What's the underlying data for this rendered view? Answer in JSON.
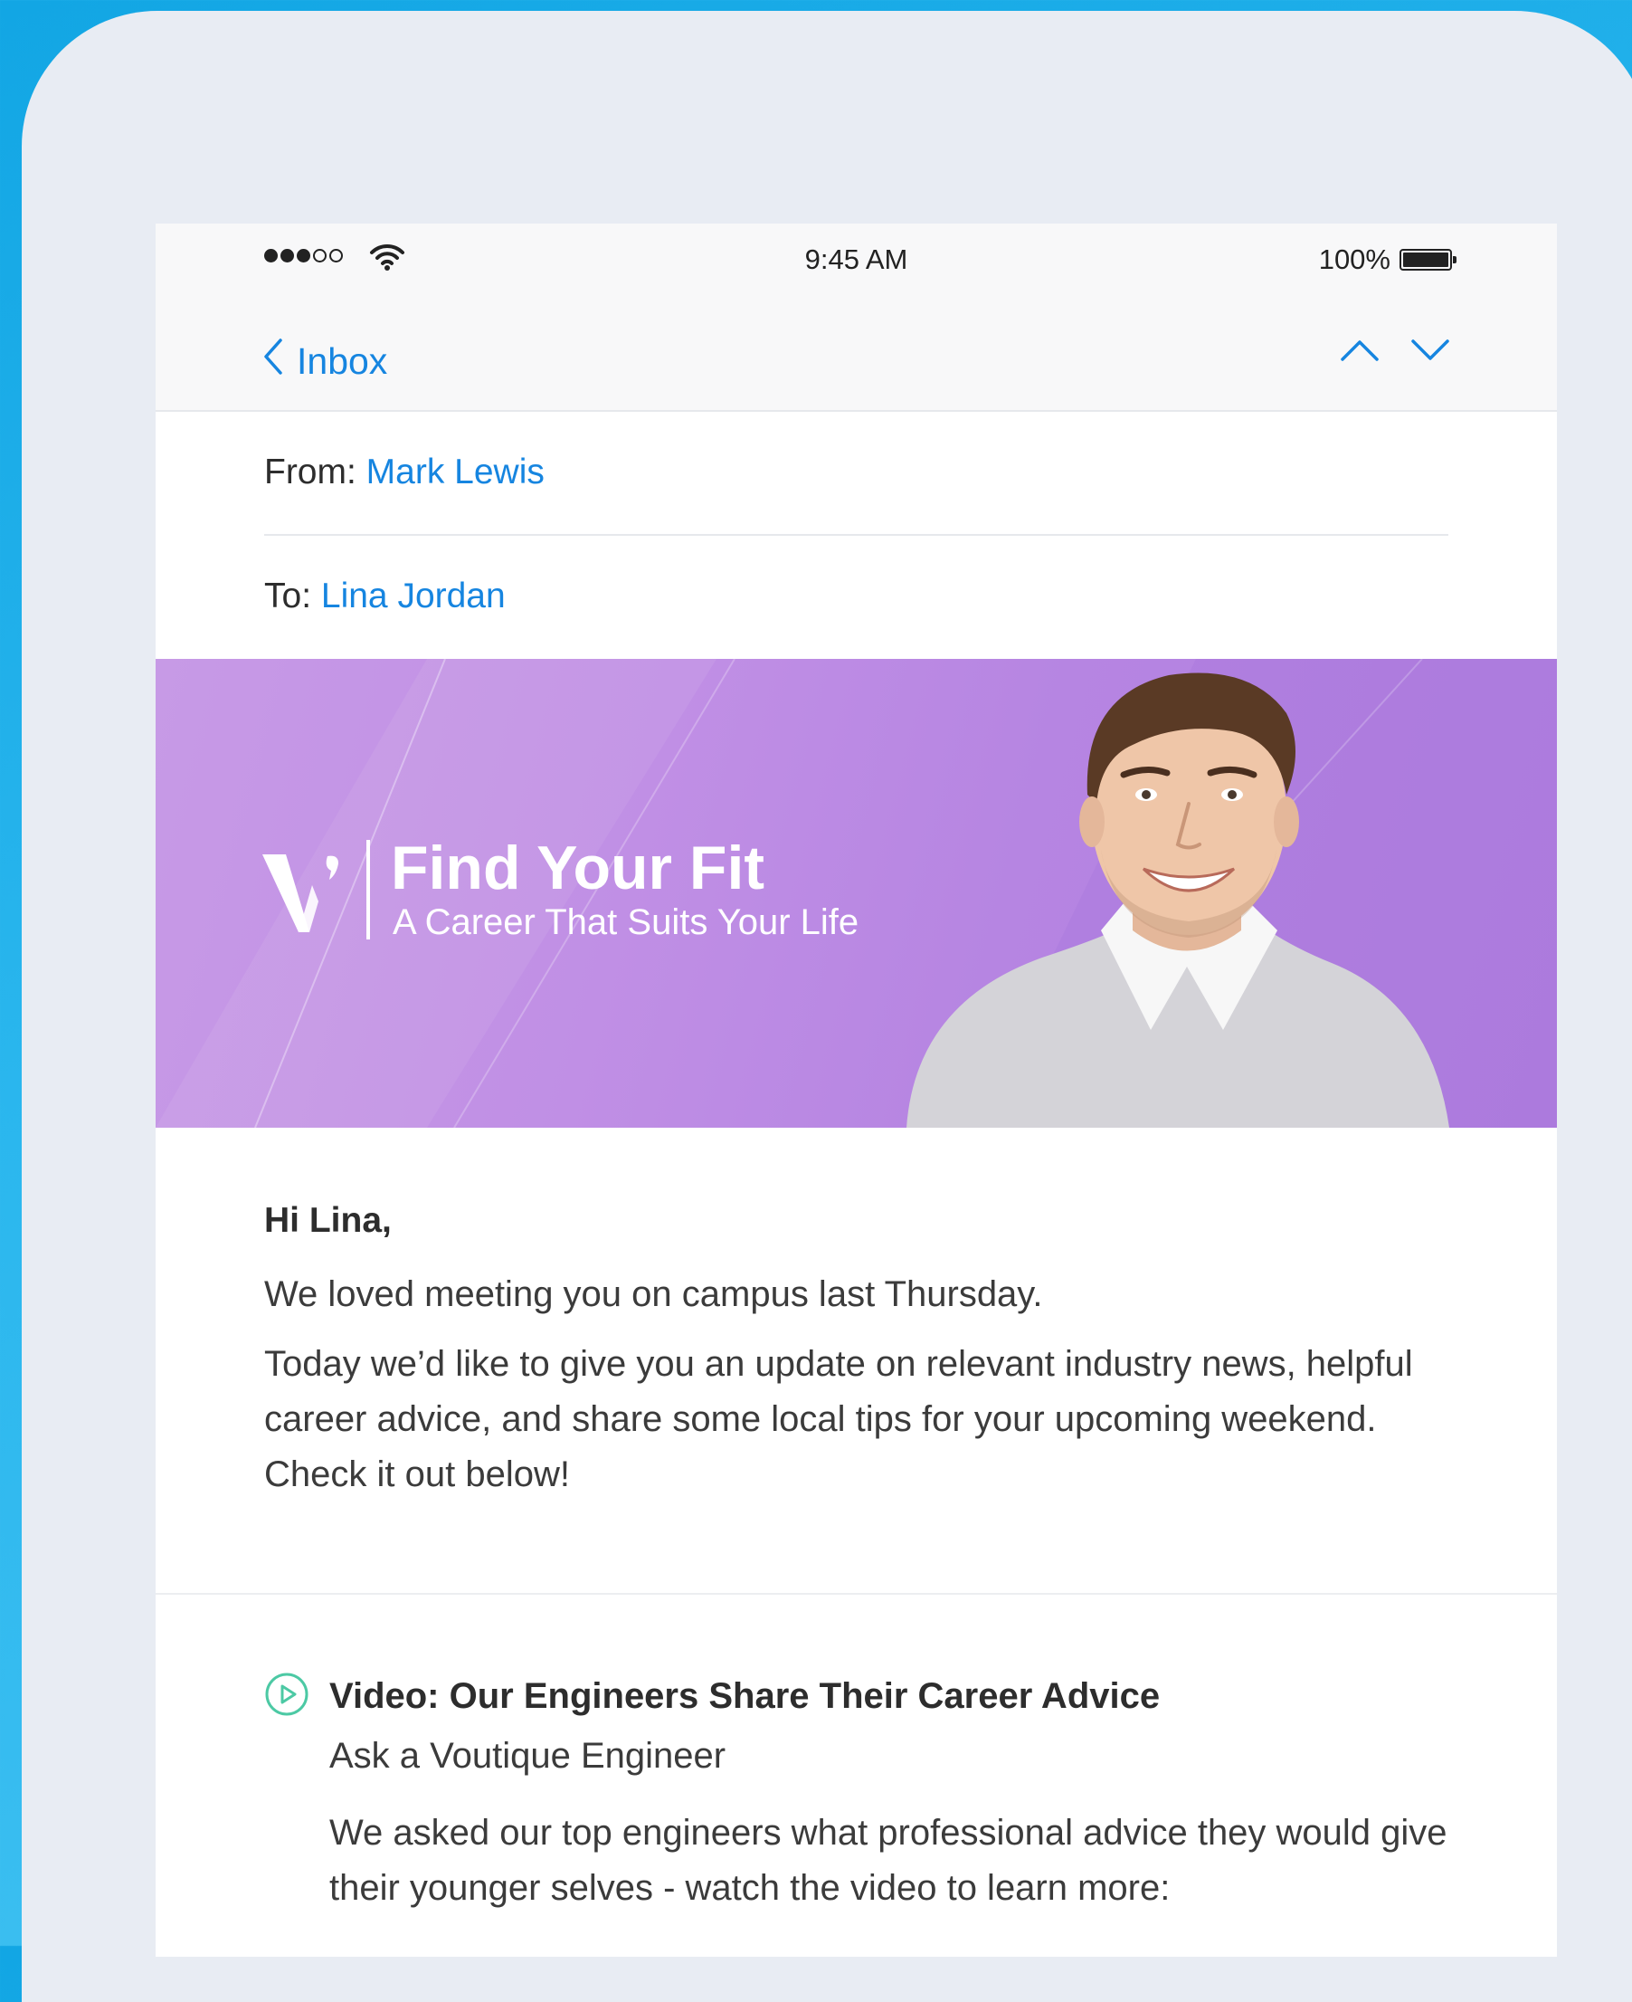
{
  "status_bar": {
    "time": "9:45 AM",
    "battery": "100%",
    "signal_bars_filled": 3,
    "signal_bars_total": 5
  },
  "nav": {
    "back_label": "Inbox"
  },
  "header": {
    "from_label": "From:",
    "from_value": "Mark Lewis",
    "to_label": "To:",
    "to_value": "Lina Jordan"
  },
  "banner": {
    "title": "Find Your Fit",
    "subtitle": "A Career That Suits Your Life"
  },
  "body": {
    "greeting": "Hi Lina,",
    "paragraph1": "We loved meeting you on campus last Thursday.",
    "paragraph2": "Today we’d like to give you an update on relevant industry news, helpful career advice, and share some local tips for your upcoming weekend. Check it out below!"
  },
  "video": {
    "title": "Video: Our Engineers Share Their Career Advice",
    "subtitle": "Ask a Voutique Engineer",
    "description": "We asked our top engineers what professional advice they would give their younger selves - watch the video to learn more:"
  },
  "colors": {
    "link": "#1685e0",
    "banner": "#c08fe5",
    "play_icon": "#4cc9a4",
    "background": "#1aa9e6"
  },
  "icons": {
    "back": "chevron-left-icon",
    "prev": "chevron-up-icon",
    "next": "chevron-down-icon",
    "wifi": "wifi-icon",
    "battery": "battery-icon",
    "play": "play-circle-icon",
    "logo": "voutique-logo"
  }
}
